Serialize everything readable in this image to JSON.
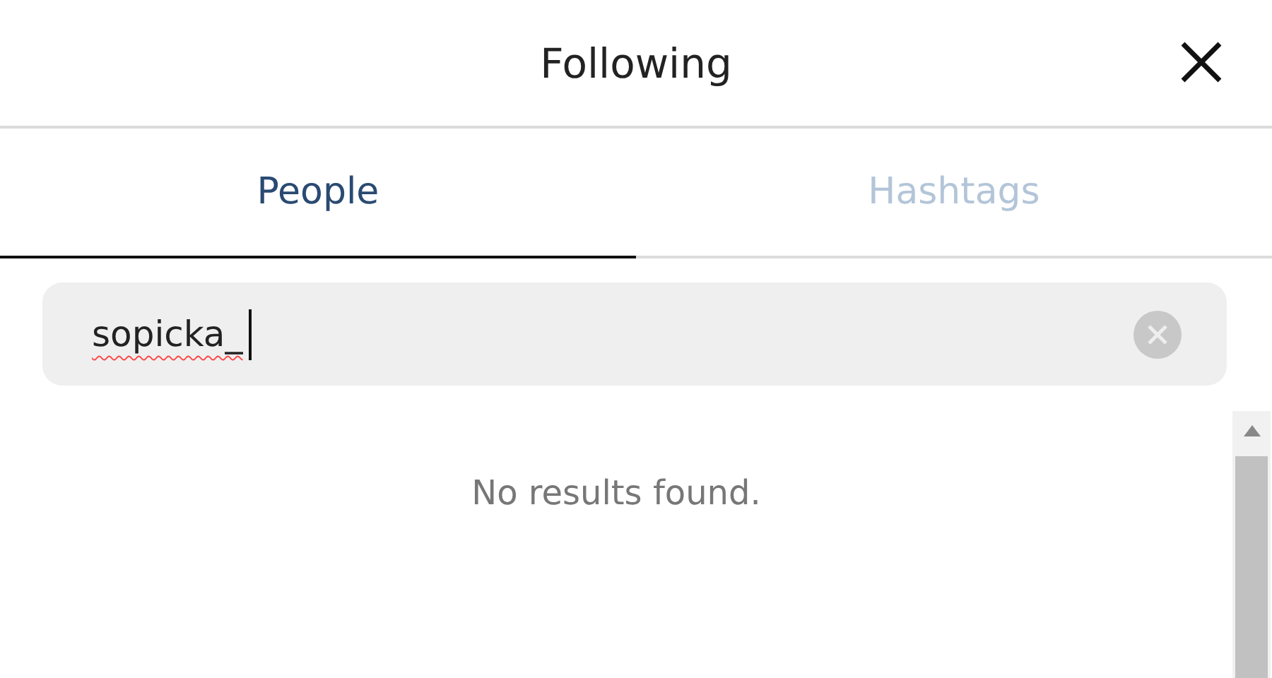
{
  "header": {
    "title": "Following"
  },
  "tabs": [
    {
      "label": "People",
      "selected": true
    },
    {
      "label": "Hashtags",
      "selected": false
    }
  ],
  "search": {
    "value": "sopicka_"
  },
  "results": {
    "message": "No results found."
  }
}
